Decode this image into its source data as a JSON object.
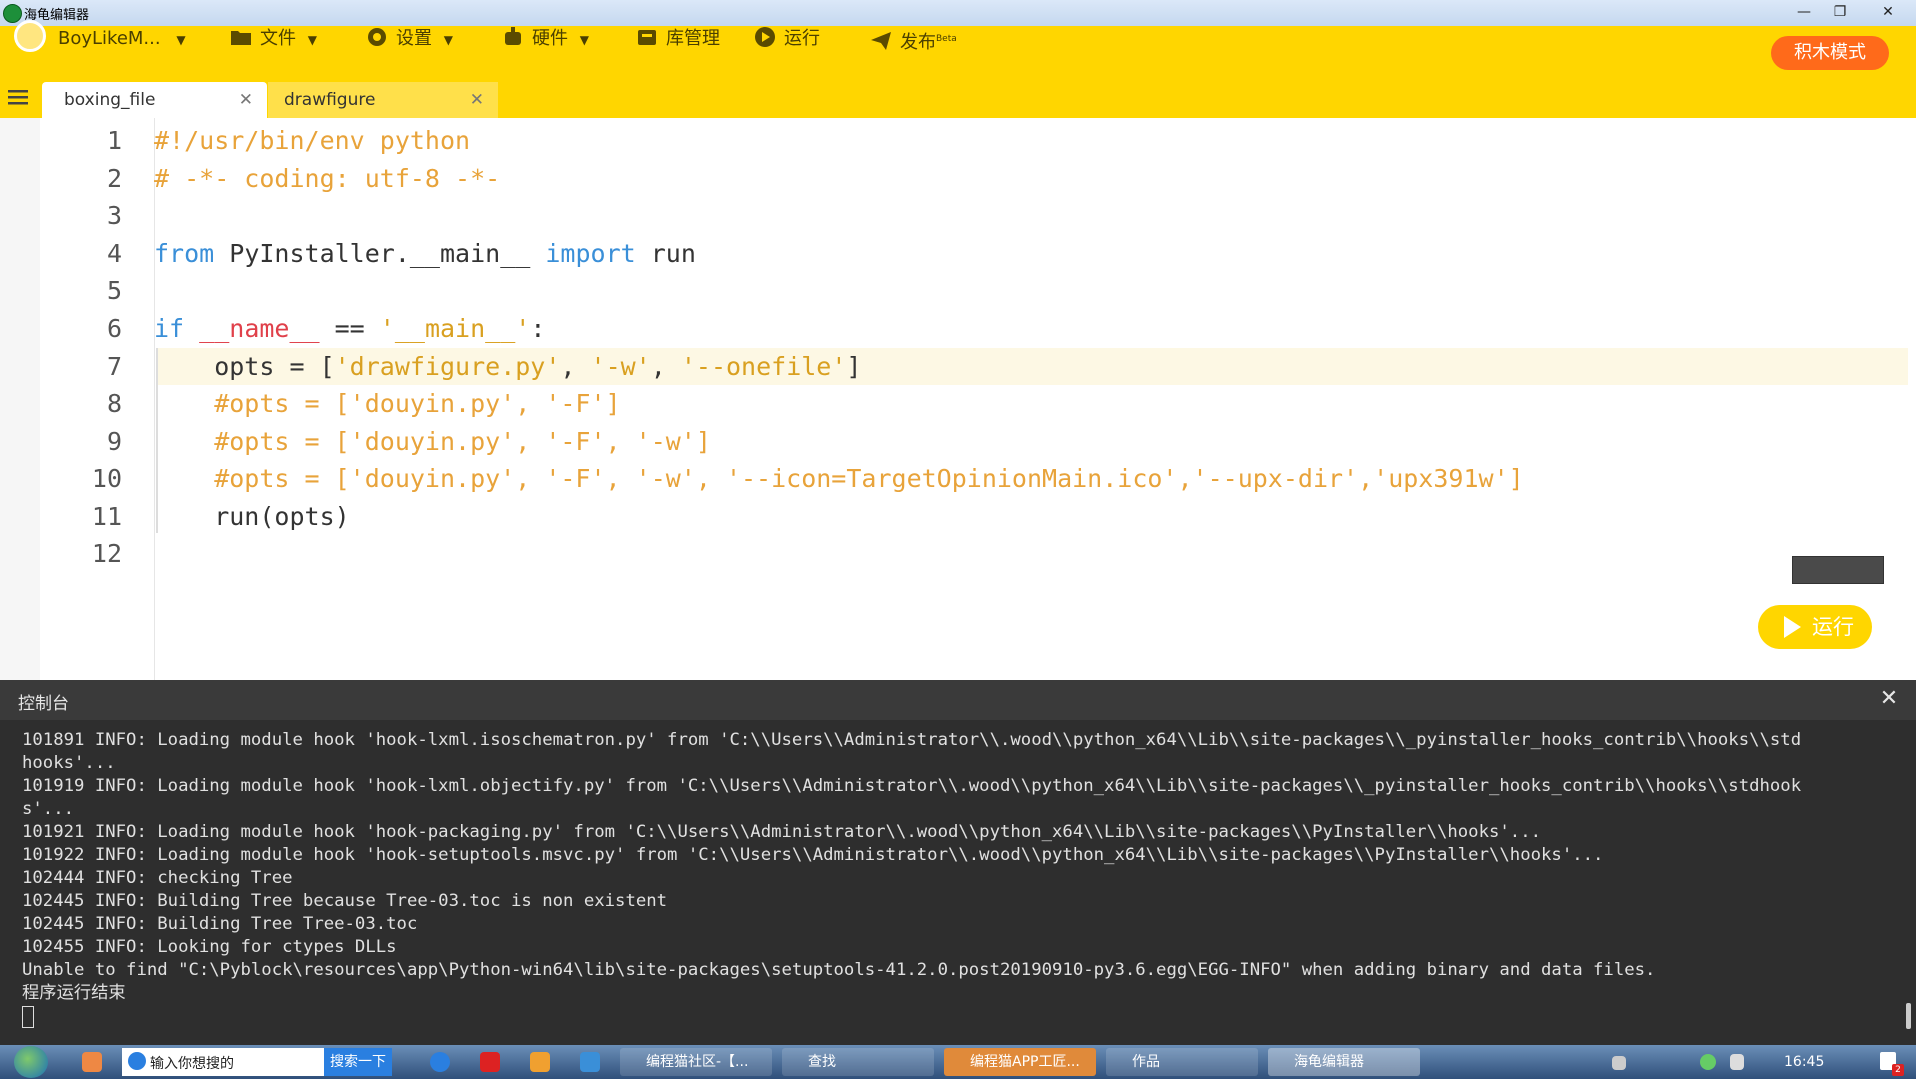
{
  "window": {
    "title": "海龟编辑器"
  },
  "toolbar": {
    "user": "BoyLikeM...",
    "file": "文件",
    "settings": "设置",
    "hardware": "硬件",
    "library": "库管理",
    "run": "运行",
    "publish": "发布",
    "publish_badge": "Beta",
    "block_mode": "积木模式"
  },
  "tabs": [
    {
      "label": "boxing_file"
    },
    {
      "label": "drawfigure"
    }
  ],
  "editor": {
    "line_numbers": [
      "1",
      "2",
      "3",
      "4",
      "5",
      "6",
      "7",
      "8",
      "9",
      "10",
      "11",
      "12"
    ],
    "lines": {
      "l1": "#!/usr/bin/env python",
      "l2": "# -*- coding: utf-8 -*-",
      "l4_kw1": "from",
      "l4_mod": " PyInstaller.__main__ ",
      "l4_kw2": "import",
      "l4_rest": " run",
      "l6_kw": "if",
      "l6_name": " __name__",
      "l6_op": " == ",
      "l6_str": "'__main__'",
      "l6_colon": ":",
      "l7_a": "    opts = [",
      "l7_s1": "'drawfigure.py'",
      "l7_c1": ", ",
      "l7_s2": "'-w'",
      "l7_c2": ", ",
      "l7_s3": "'--onefile'",
      "l7_b": "]",
      "l8": "    #opts = ['douyin.py', '-F']",
      "l9": "    #opts = ['douyin.py', '-F', '-w']",
      "l10": "    #opts = ['douyin.py', '-F', '-w', '--icon=TargetOpinionMain.ico','--upx-dir','upx391w']",
      "l11": "    run(opts)"
    },
    "run_button": "运行"
  },
  "console": {
    "title": "控制台",
    "lines": [
      "101891 INFO: Loading module hook 'hook-lxml.isoschematron.py' from 'C:\\\\Users\\\\Administrator\\\\.wood\\\\python_x64\\\\Lib\\\\site-packages\\\\_pyinstaller_hooks_contrib\\\\hooks\\\\std",
      "hooks'...",
      "101919 INFO: Loading module hook 'hook-lxml.objectify.py' from 'C:\\\\Users\\\\Administrator\\\\.wood\\\\python_x64\\\\Lib\\\\site-packages\\\\_pyinstaller_hooks_contrib\\\\hooks\\\\stdhook",
      "s'...",
      "101921 INFO: Loading module hook 'hook-packaging.py' from 'C:\\\\Users\\\\Administrator\\\\.wood\\\\python_x64\\\\Lib\\\\site-packages\\\\PyInstaller\\\\hooks'...",
      "101922 INFO: Loading module hook 'hook-setuptools.msvc.py' from 'C:\\\\Users\\\\Administrator\\\\.wood\\\\python_x64\\\\Lib\\\\site-packages\\\\PyInstaller\\\\hooks'...",
      "102444 INFO: checking Tree",
      "102445 INFO: Building Tree because Tree-03.toc is non existent",
      "102445 INFO: Building Tree Tree-03.toc",
      "102455 INFO: Looking for ctypes DLLs",
      "Unable to find \"C:\\Pyblock\\resources\\app\\Python-win64\\lib\\site-packages\\setuptools-41.2.0.post20190910-py3.6.egg\\EGG-INFO\" when adding binary and data files.",
      "程序运行结束"
    ]
  },
  "taskbar": {
    "search_placeholder": "输入你想搜的",
    "search_button": "搜索一下",
    "items": [
      "编程猫社区-【...",
      "查找",
      "编程猫APP工匠...",
      "作品",
      "海龟编辑器"
    ],
    "clock": "16:45",
    "notif_count": "2"
  },
  "colors": {
    "toolbar": "#ffd600",
    "keyword": "#3a8fd8",
    "comment": "#e8a33a",
    "block_mode_btn": "#ff6a1a",
    "console_bg": "#2e2e2e"
  }
}
